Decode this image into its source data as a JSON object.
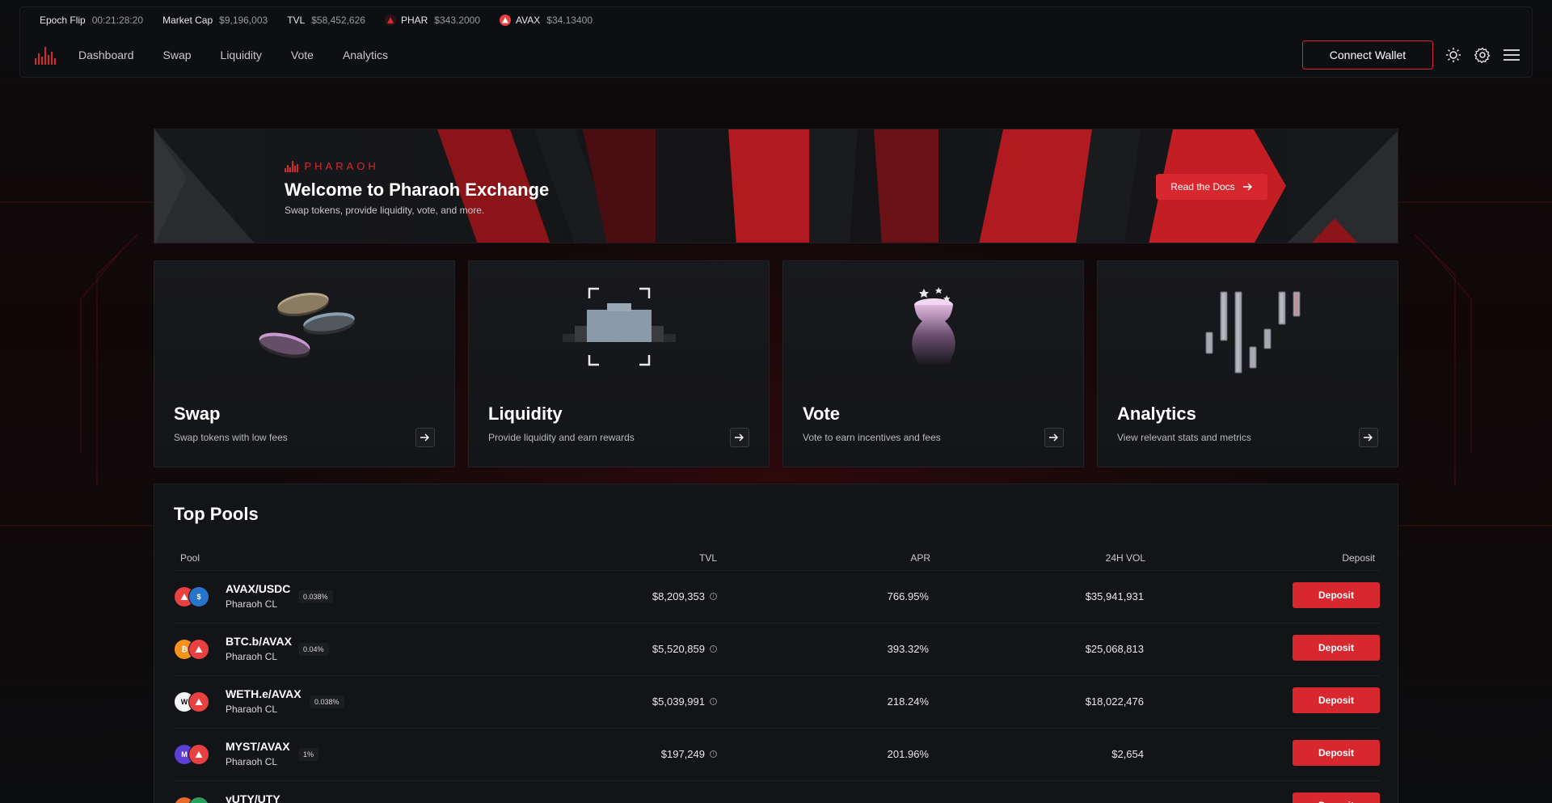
{
  "ticker": {
    "epoch_label": "Epoch Flip",
    "epoch_value": "00:21:28:20",
    "mcap_label": "Market Cap",
    "mcap_value": "$9,196,003",
    "tvl_label": "TVL",
    "tvl_value": "$58,452,626",
    "phar_label": "PHAR",
    "phar_value": "$343.2000",
    "avax_label": "AVAX",
    "avax_value": "$34.13400"
  },
  "nav": {
    "items": [
      "Dashboard",
      "Swap",
      "Liquidity",
      "Vote",
      "Analytics"
    ],
    "connect": "Connect Wallet"
  },
  "hero": {
    "brand": "PHARAOH",
    "title": "Welcome to Pharaoh Exchange",
    "subtitle": "Swap tokens, provide liquidity, vote, and more.",
    "docs": "Read the Docs"
  },
  "cards": [
    {
      "title": "Swap",
      "desc": "Swap tokens with low fees"
    },
    {
      "title": "Liquidity",
      "desc": "Provide liquidity and earn rewards"
    },
    {
      "title": "Vote",
      "desc": "Vote to earn incentives and fees"
    },
    {
      "title": "Analytics",
      "desc": "View relevant stats and metrics"
    }
  ],
  "pools": {
    "title": "Top Pools",
    "headers": {
      "pool": "Pool",
      "tvl": "TVL",
      "apr": "APR",
      "vol": "24H VOL",
      "deposit": "Deposit"
    },
    "deposit_label": "Deposit",
    "rows": [
      {
        "name": "AVAX/USDC",
        "type": "Pharaoh CL",
        "fee": "0.038%",
        "tvl": "$8,209,353",
        "apr": "766.95%",
        "vol": "$35,941,931"
      },
      {
        "name": "BTC.b/AVAX",
        "type": "Pharaoh CL",
        "fee": "0.04%",
        "tvl": "$5,520,859",
        "apr": "393.32%",
        "vol": "$25,068,813"
      },
      {
        "name": "WETH.e/AVAX",
        "type": "Pharaoh CL",
        "fee": "0.038%",
        "tvl": "$5,039,991",
        "apr": "218.24%",
        "vol": "$18,022,476"
      },
      {
        "name": "MYST/AVAX",
        "type": "Pharaoh CL",
        "fee": "1%",
        "tvl": "$197,249",
        "apr": "201.96%",
        "vol": "$2,654"
      },
      {
        "name": "yUTY/UTY",
        "type": "",
        "fee": "",
        "tvl": "",
        "apr": "",
        "vol": ""
      }
    ]
  },
  "colors": {
    "accent": "#d8282f",
    "bg": "#0b0c0e",
    "card": "#18191c"
  }
}
